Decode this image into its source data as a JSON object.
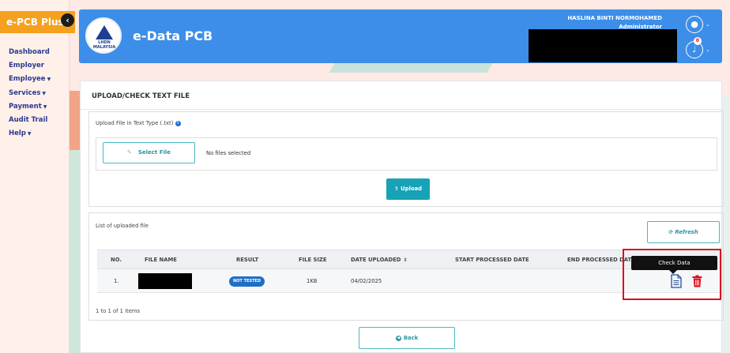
{
  "sidebar": {
    "brand": "e-PCB Plus",
    "collapse_icon": "chevron-left-icon",
    "items": [
      {
        "label": "Dashboard",
        "has_caret": false
      },
      {
        "label": "Employer",
        "has_caret": false
      },
      {
        "label": "Employee",
        "has_caret": true
      },
      {
        "label": "Services",
        "has_caret": true
      },
      {
        "label": "Payment",
        "has_caret": true
      },
      {
        "label": "Audit Trail",
        "has_caret": false
      },
      {
        "label": "Help",
        "has_caret": true
      }
    ]
  },
  "header": {
    "logo_text": "LHDN MALAYSIA",
    "title": "e-Data PCB",
    "user_name": "HASLINA BINTI NORMOHAMED",
    "user_role": "Administrator",
    "notification_count": "0",
    "avatar_icon": "user-icon",
    "bell_icon": "bell-icon"
  },
  "page": {
    "title": "UPLOAD/CHECK TEXT FILE"
  },
  "upload": {
    "label": "Upload File in Text Type (.txt)",
    "select_button": "Select File",
    "no_files_text": "No files selected",
    "upload_button": "Upload"
  },
  "file_list": {
    "label": "List of uploaded file",
    "refresh_button": "Refresh",
    "columns": [
      "NO.",
      "FILE NAME",
      "RESULT",
      "FILE SIZE",
      "DATE UPLOADED",
      "START PROCESSED DATE",
      "END PROCESSED DATE"
    ],
    "rows": [
      {
        "no": "1.",
        "file_name": "",
        "result": "NOT TESTED",
        "file_size": "1KB",
        "date_uploaded": "04/02/2025",
        "start_processed": "",
        "end_processed": ""
      }
    ],
    "pagination_info": "1 to 1 of 1 items"
  },
  "tooltip": {
    "text": "Check Data"
  },
  "back_button": "Back",
  "colors": {
    "header_blue": "#3d8ee8",
    "brand_orange": "#f5a11f",
    "teal_button": "#17a2b8",
    "badge_blue": "#1f6fc7",
    "delete_red": "#d8101e",
    "highlight_red": "#d8101e"
  }
}
